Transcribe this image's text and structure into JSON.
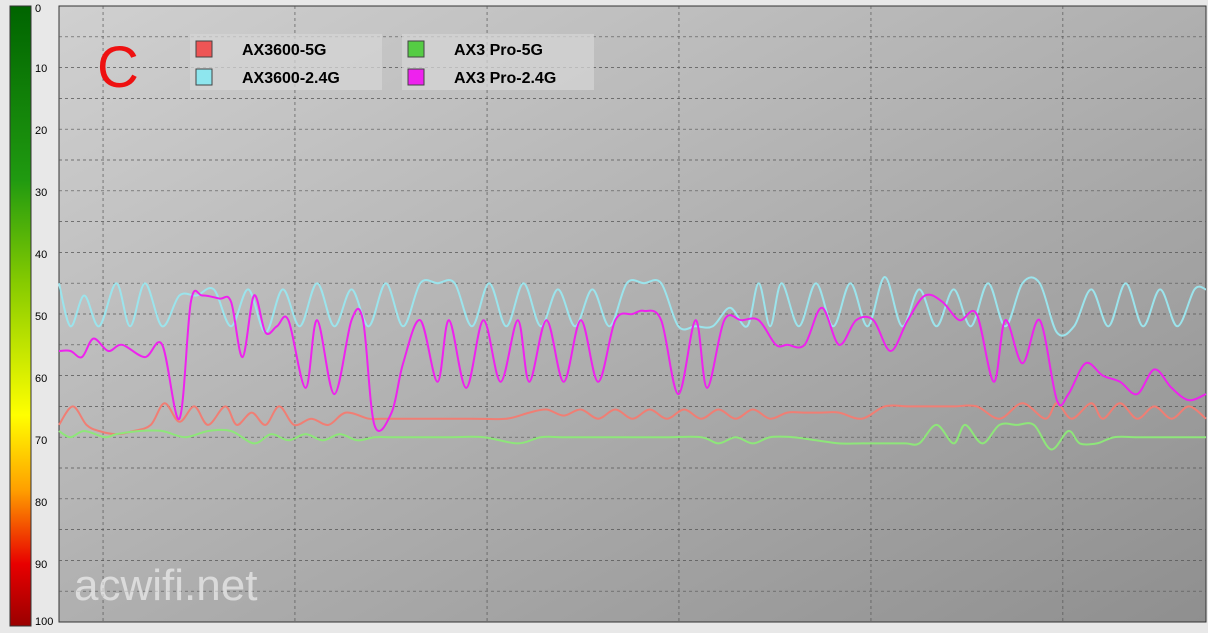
{
  "chart_data": {
    "type": "line",
    "panel_label": "C",
    "watermark": "acwifi.net",
    "y_axis": {
      "min": 0,
      "max": 100,
      "inverted": true,
      "ticks": [
        0,
        10,
        20,
        30,
        40,
        50,
        60,
        70,
        80,
        90,
        100
      ]
    },
    "x_axis": {
      "min": 0,
      "max": 100,
      "tick_labels_shown": false
    },
    "grid": true,
    "legend_placement": "top-left",
    "colors": {
      "plot_bg_top": "#d0d0d0",
      "plot_bg_bottom": "#8f8f8f",
      "grid": "#555555"
    },
    "series": [
      {
        "name": "AX3600-5G",
        "color": "#f07e74",
        "legend_swatch": "#ee5555",
        "x": [
          0,
          1.2,
          2.4,
          3.5,
          5,
          6.5,
          8,
          9.2,
          10.5,
          11.8,
          13,
          14.5,
          15.5,
          16.8,
          18,
          19.2,
          20.5,
          22,
          23.5,
          25,
          27,
          28,
          30,
          33,
          36,
          39,
          41,
          42.5,
          44,
          45.5,
          47,
          48.5,
          50,
          51.5,
          53,
          54.5,
          56,
          57.5,
          59,
          60.5,
          62,
          63.5,
          65,
          66.5,
          68,
          70,
          72,
          74,
          76,
          78,
          80,
          82,
          84,
          86,
          87,
          88.3,
          90,
          91,
          92.5,
          94,
          95.5,
          97,
          98.5,
          100
        ],
        "y": [
          68,
          65,
          68,
          69,
          69.5,
          69,
          68,
          64.5,
          67.5,
          65,
          68,
          65,
          68,
          66,
          68,
          65,
          68,
          67,
          68,
          66,
          67,
          67,
          67,
          67,
          67,
          67,
          66,
          65.5,
          66.5,
          65.5,
          67,
          65.5,
          67,
          65.5,
          67,
          65.5,
          67,
          65.5,
          67,
          65.5,
          67,
          66,
          66,
          66,
          66,
          67,
          65,
          65,
          65,
          65,
          65,
          67,
          64.5,
          67,
          64.5,
          67,
          64.5,
          67,
          64.5,
          67,
          65,
          67,
          65,
          67
        ]
      },
      {
        "name": "AX3600-2.4G",
        "color": "#9be4ec",
        "legend_swatch": "#8ee6ee",
        "x": [
          0,
          1,
          2.2,
          3.5,
          5,
          6.2,
          7.5,
          9,
          10.5,
          12,
          13.5,
          15,
          16.5,
          18,
          19.5,
          21,
          22.5,
          24,
          25.5,
          27,
          28.5,
          30,
          31.5,
          33,
          34.5,
          36,
          37.5,
          39,
          40.5,
          42,
          43.5,
          45,
          46.5,
          48,
          49.5,
          51,
          52.5,
          54,
          55.5,
          57,
          58.5,
          60,
          61,
          62,
          63,
          64.5,
          66,
          67.5,
          69,
          70.5,
          72,
          73.5,
          75,
          76.5,
          78,
          79.5,
          81,
          82.5,
          84,
          85.5,
          87,
          88.5,
          90,
          91.5,
          93,
          94.5,
          96,
          97.5,
          99,
          100
        ],
        "y": [
          45,
          52,
          47,
          52,
          45,
          52,
          45,
          52,
          47,
          47,
          46,
          52,
          46,
          53,
          46,
          52,
          45,
          52,
          46,
          52,
          45,
          52,
          45,
          45,
          45,
          52,
          45,
          52,
          45,
          52,
          46,
          52,
          46,
          52,
          45,
          45,
          45,
          52,
          52,
          52,
          49,
          52,
          45,
          52,
          45,
          52,
          45,
          52,
          45,
          52,
          44,
          52,
          46,
          52,
          46,
          52,
          45,
          52,
          45,
          45,
          53,
          52,
          46,
          52,
          45,
          52,
          46,
          52,
          46,
          46
        ]
      },
      {
        "name": "AX3 Pro-5G",
        "color": "#8ee67a",
        "legend_swatch": "#55cc44",
        "x": [
          0,
          1,
          2.2,
          4,
          5,
          7,
          9,
          11,
          13,
          15,
          17,
          18.5,
          20,
          21.5,
          23,
          24.5,
          26,
          27.5,
          29,
          31,
          34,
          37,
          40,
          42,
          44,
          47,
          50,
          53,
          56,
          57.5,
          59,
          60.5,
          62,
          64,
          66,
          68,
          70,
          72,
          73.8,
          75,
          76.5,
          78,
          79,
          80.5,
          82,
          83.5,
          85,
          86.5,
          88,
          89,
          90.5,
          92,
          94,
          96,
          98,
          100
        ],
        "y": [
          69,
          70,
          69,
          70,
          69.5,
          69,
          69,
          70,
          69,
          69,
          71,
          69.5,
          70.5,
          69.5,
          70.5,
          69.5,
          70.5,
          70,
          70,
          70,
          70,
          70,
          71,
          70,
          70,
          70,
          70,
          70,
          70,
          71,
          70,
          71,
          70,
          70,
          70.5,
          71,
          71,
          71,
          71,
          71,
          68,
          71,
          68,
          71,
          68,
          68,
          68,
          72,
          69,
          71,
          71,
          70,
          70,
          70,
          70,
          70
        ]
      },
      {
        "name": "AX3 Pro-2.4G",
        "color": "#ee22ee",
        "legend_swatch": "#ee22ee",
        "x": [
          0,
          1,
          2,
          3,
          4.3,
          5.5,
          7.5,
          9,
          10.5,
          11.5,
          12.5,
          14,
          15,
          16,
          17,
          18,
          19,
          20,
          21.5,
          22.5,
          24,
          25.5,
          26.5,
          27.5,
          29,
          30,
          31.5,
          33,
          34,
          35.5,
          37,
          38.5,
          40,
          41,
          42.5,
          44,
          45.5,
          47,
          48.5,
          50,
          51,
          52.5,
          54,
          55.5,
          56.5,
          58,
          59.5,
          61,
          62.5,
          63.5,
          65,
          66.5,
          68,
          69.5,
          71,
          72.5,
          74,
          75.5,
          77,
          78.5,
          80,
          81.5,
          82.5,
          84,
          85.5,
          87,
          88,
          89.5,
          91,
          92.5,
          94,
          95.5,
          97,
          98.5,
          100
        ],
        "y": [
          56,
          56,
          57,
          54,
          56,
          55,
          57,
          55,
          67,
          48,
          47,
          47.5,
          48,
          57,
          47,
          53,
          52,
          51,
          62,
          51,
          63,
          51,
          51,
          68,
          66,
          58,
          51,
          61,
          51,
          62,
          51,
          61,
          51,
          61,
          51,
          61,
          51,
          61,
          51,
          50,
          49.5,
          51,
          63,
          51,
          62,
          51,
          51,
          51,
          55,
          55,
          55,
          49,
          55,
          51,
          51,
          56,
          51,
          47,
          48,
          51,
          50,
          61,
          51,
          58,
          51,
          64,
          63,
          58,
          60,
          61,
          63,
          59,
          62,
          64,
          63
        ]
      }
    ]
  }
}
